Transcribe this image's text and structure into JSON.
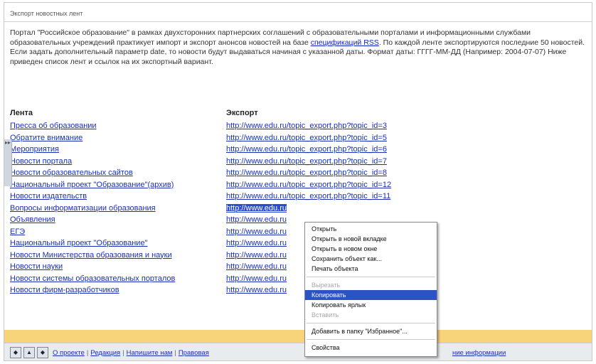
{
  "header": {
    "title": "Экспорт новостных лент"
  },
  "intro": {
    "text_before_link": "Портал \"Российское образование\" в рамках двухсторонних партнерских соглашений с образовательными порталами и информационными службами образовательных учреждений практикует импорт и экспорт анонсов новостей на базе ",
    "link_text": "спецификаций RSS",
    "text_after_link": ". По каждой ленте экспортируются последние 50 новостей. Если задать дополнительный параметр date, то новости будут выдаваться начиная с указанной даты. Формат даты: ГГГГ-ММ-ДД (Например: 2004-07-07) Ниже приведен список лент и ссылок на их экспортный вариант."
  },
  "table": {
    "col_feed": "Лента",
    "col_export": "Экспорт",
    "feeds": [
      "Пресса об образовании",
      "Обратите внимание",
      "Мероприятия",
      "Новости портала",
      "Новости образовательных сайтов",
      "Национальный проект \"Образование\"(архив)",
      "Новости издательств",
      "Вопросы информатизации образования",
      "Объявления",
      "ЕГЭ",
      "Национальный проект \"Образование\"",
      "Новости Министерства образования и науки",
      "Новости науки",
      "Новости системы образовательных порталов",
      "Новости фирм-разработчиков"
    ],
    "exports": [
      "http://www.edu.ru/topic_export.php?topic_id=3",
      "http://www.edu.ru/topic_export.php?topic_id=5",
      "http://www.edu.ru/topic_export.php?topic_id=6",
      "http://www.edu.ru/topic_export.php?topic_id=7",
      "http://www.edu.ru/topic_export.php?topic_id=8",
      "http://www.edu.ru/topic_export.php?topic_id=12",
      "http://www.edu.ru/topic_export.php?topic_id=11",
      "http://www.edu.ru",
      "http://www.edu.ru",
      "http://www.edu.ru",
      "http://www.edu.ru",
      "http://www.edu.ru",
      "http://www.edu.ru",
      "http://www.edu.ru",
      "http://www.edu.ru"
    ],
    "selected_export_index": 7
  },
  "context_menu": {
    "items": [
      {
        "label": "Открыть",
        "state": "normal"
      },
      {
        "label": "Открыть в новой вкладке",
        "state": "normal"
      },
      {
        "label": "Открыть в новом окне",
        "state": "normal"
      },
      {
        "label": "Сохранить объект как...",
        "state": "normal"
      },
      {
        "label": "Печать объекта",
        "state": "normal"
      },
      {
        "label": "Вырезать",
        "state": "disabled"
      },
      {
        "label": "Копировать",
        "state": "highlight"
      },
      {
        "label": "Копировать ярлык",
        "state": "normal"
      },
      {
        "label": "Вставить",
        "state": "disabled"
      },
      {
        "label": "Добавить в папку \"Избранное\"...",
        "state": "normal"
      },
      {
        "label": "Свойства",
        "state": "normal"
      }
    ]
  },
  "footer": {
    "links": [
      "О проекте",
      "Редакция",
      "Напишите нам",
      "Правовая"
    ],
    "right_link": "ние информации",
    "nav_icons": [
      "diamond-icon",
      "up-arrow-icon",
      "diamond-icon"
    ]
  },
  "colors": {
    "link": "#1a2fb5",
    "selection": "#2b4bd1",
    "menu_highlight": "#2c52c4",
    "footer_band": "#f7d37a"
  }
}
